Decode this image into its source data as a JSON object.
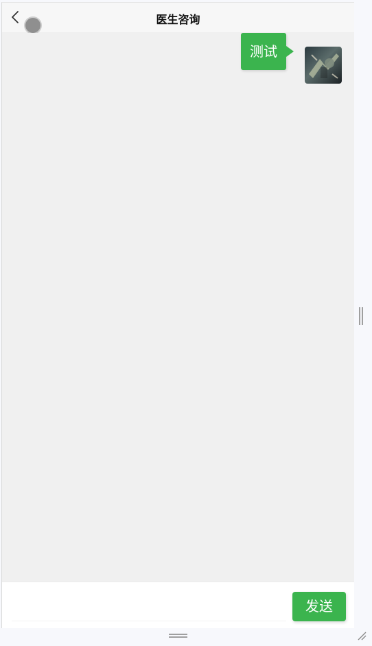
{
  "header": {
    "title": "医生咨询"
  },
  "messages": [
    {
      "text": "测试",
      "sender": "self",
      "avatar": "user-avatar"
    }
  ],
  "composer": {
    "input_value": "",
    "placeholder": "",
    "send_label": "发送"
  },
  "icons": {
    "back": "chevron-left-icon",
    "floating": "floating-dot-icon",
    "resize": "resize-grip-icon"
  },
  "colors": {
    "accent": "#3bb44e",
    "background": "#f0f0f0",
    "header": "#f7f7f7"
  }
}
